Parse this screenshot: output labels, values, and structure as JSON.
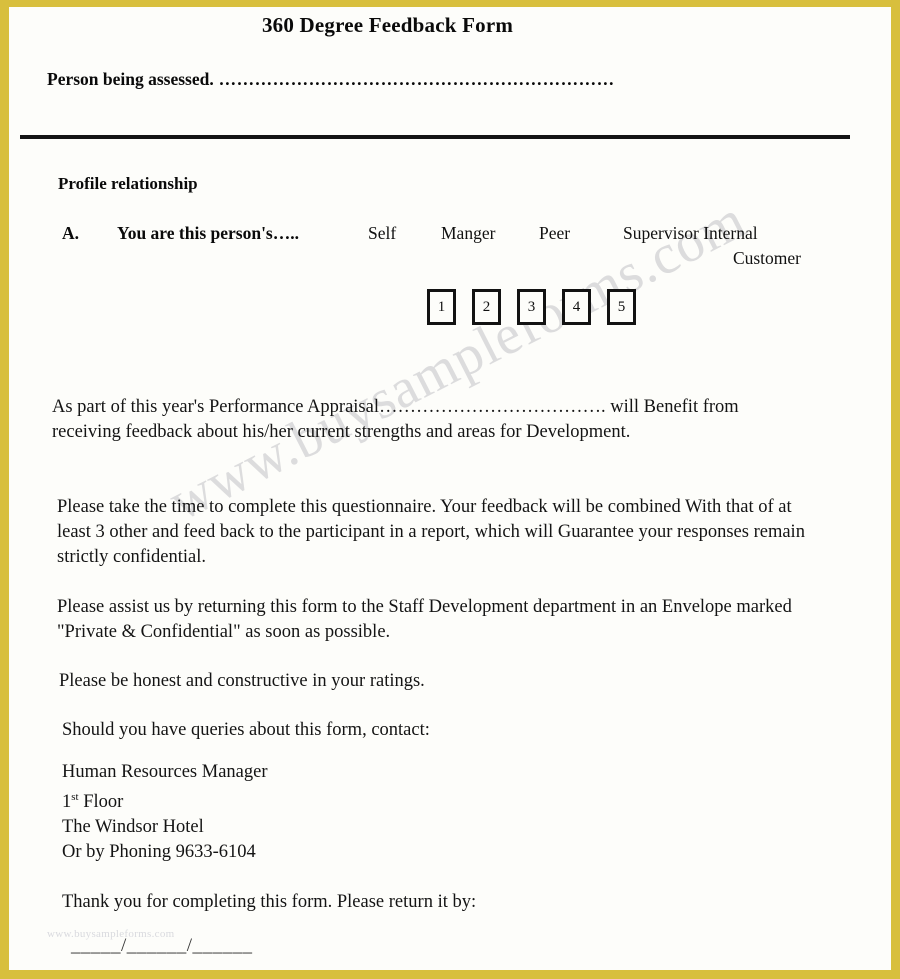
{
  "document": {
    "title": "360 Degree Feedback Form",
    "border_color": "#d8bf3d",
    "page_color": "#fdfdfa"
  },
  "watermark": {
    "text": "www.buysampleforms.com",
    "color": "#c9c9cc",
    "bottom_text": "www.buysampleforms.com"
  },
  "assessed": {
    "label": "Person being assessed.",
    "leader": " …………………………………………………………"
  },
  "profile": {
    "heading": "Profile relationship",
    "question_letter": "A.",
    "question_text": "You are this person's…..",
    "options": [
      {
        "label": "Self"
      },
      {
        "label": "Manger"
      },
      {
        "label": "Peer"
      },
      {
        "label": "Supervisor Internal"
      },
      {
        "label": "Customer"
      }
    ],
    "boxes": [
      "1",
      "2",
      "3",
      "4",
      "5"
    ]
  },
  "body": {
    "paragraph_1": "As part of this year's Performance Appraisal………………………………. will Benefit from receiving feedback about his/her current strengths and areas for Development.",
    "paragraph_2": "Please take the time to complete this questionnaire. Your feedback will be combined With that of at least 3 other and feed back to the participant in a report, which will Guarantee your responses remain strictly confidential.",
    "paragraph_3": "Please assist us by returning this form to the Staff Development department in an Envelope marked \"Private & Confidential\" as soon as possible.",
    "paragraph_4": "Please be honest and constructive in your ratings.",
    "paragraph_5": "Should you have queries about this form, contact:"
  },
  "contact": {
    "line_1": "Human Resources Manager",
    "floor_number": "1",
    "floor_ordinal": "st",
    "floor_word": " Floor",
    "line_3": "The Windsor Hotel",
    "line_4": "Or by Phoning 9633-6104"
  },
  "closing": {
    "text": "Thank you for completing this form. Please return it by:",
    "date_line": "_____/______/______"
  }
}
